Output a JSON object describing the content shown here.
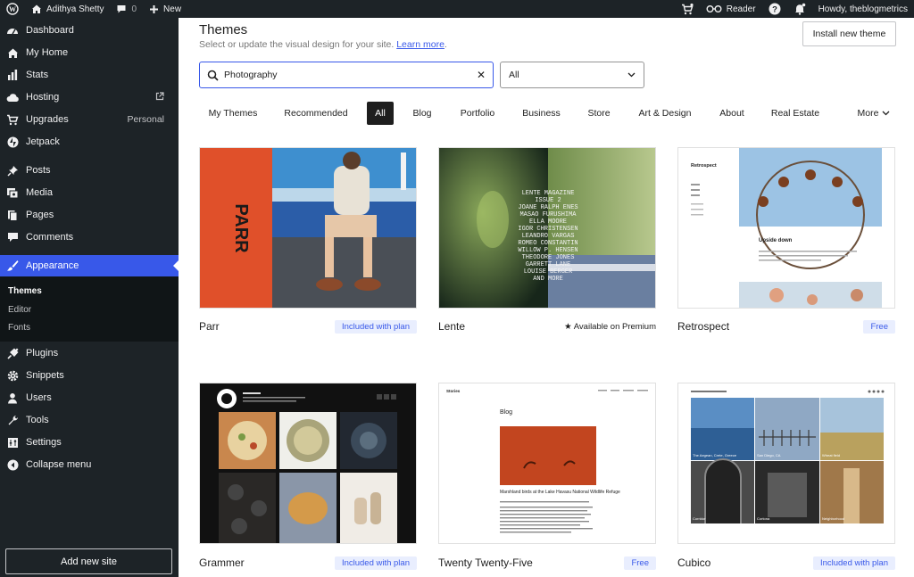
{
  "adminbar": {
    "site_name": "Adithya Shetty",
    "comments_count": "0",
    "new_label": "New",
    "reader_label": "Reader",
    "greeting": "Howdy, theblogmetrics"
  },
  "sidebar": {
    "items": [
      {
        "label": "Dashboard",
        "icon": "dashboard-icon"
      },
      {
        "label": "My Home",
        "icon": "home-icon"
      },
      {
        "label": "Stats",
        "icon": "stats-icon"
      },
      {
        "label": "Hosting",
        "icon": "cloud-icon"
      },
      {
        "label": "Upgrades",
        "icon": "cart-icon",
        "extra": "Personal"
      },
      {
        "label": "Jetpack",
        "icon": "jetpack-icon"
      },
      {
        "label": "Posts",
        "icon": "pin-icon"
      },
      {
        "label": "Media",
        "icon": "media-icon"
      },
      {
        "label": "Pages",
        "icon": "pages-icon"
      },
      {
        "label": "Comments",
        "icon": "comments-icon"
      },
      {
        "label": "Appearance",
        "icon": "brush-icon"
      },
      {
        "label": "Plugins",
        "icon": "plugin-icon"
      },
      {
        "label": "Snippets",
        "icon": "gear-icon"
      },
      {
        "label": "Users",
        "icon": "user-icon"
      },
      {
        "label": "Tools",
        "icon": "wrench-icon"
      },
      {
        "label": "Settings",
        "icon": "settings-icon"
      },
      {
        "label": "Collapse menu",
        "icon": "collapse-icon"
      }
    ],
    "submenu": [
      "Themes",
      "Editor",
      "Fonts"
    ],
    "add_site_label": "Add new site"
  },
  "main": {
    "title": "Themes",
    "subtitle": "Select or update the visual design for your site.",
    "learn_more": "Learn more",
    "install_label": "Install new theme",
    "search_value": "Photography",
    "filter_value": "All",
    "tabs": [
      "My Themes",
      "Recommended",
      "All",
      "Blog",
      "Portfolio",
      "Business",
      "Store",
      "Art & Design",
      "About",
      "Real Estate",
      "More"
    ],
    "active_tab": "All",
    "themes": [
      {
        "name": "Parr",
        "status": "Included with plan"
      },
      {
        "name": "Lente",
        "status": "Available on Premium"
      },
      {
        "name": "Retrospect",
        "status": "Free"
      },
      {
        "name": "Grammer",
        "status": "Included with plan"
      },
      {
        "name": "Twenty Twenty-Five",
        "status": "Free"
      },
      {
        "name": "Cubico",
        "status": "Included with plan"
      }
    ],
    "thumb_text": {
      "parr_word": "PARR",
      "lente_lines": [
        "LENTE MAGAZINE",
        "ISSUE 2",
        "JOANE RALPH ENES",
        "MASAO FURUSHIMA",
        "ELLA MOORE",
        "IGOR CHRISTENSEN",
        "LEANDRO VARGAS",
        "ROMEO CONSTANTIN",
        "WILLOW P. HENSEN",
        "THEODORE JONES",
        "GARRETT LANE",
        "LOUISE BERGER",
        "AND MORE"
      ],
      "retro_title": "Retrospect",
      "retro_post": "Upside down",
      "tt5_brand": "Stories",
      "tt5_heading": "Blog",
      "tt5_caption": "Marshland birds at the Lake Havasu National Wildlife Refuge",
      "cubico_captions": [
        "The Aegean, Crete, Greece",
        "San Diego, CA",
        "Wheat field",
        "Corridor",
        "Cortona",
        "Neighborhood"
      ]
    }
  }
}
